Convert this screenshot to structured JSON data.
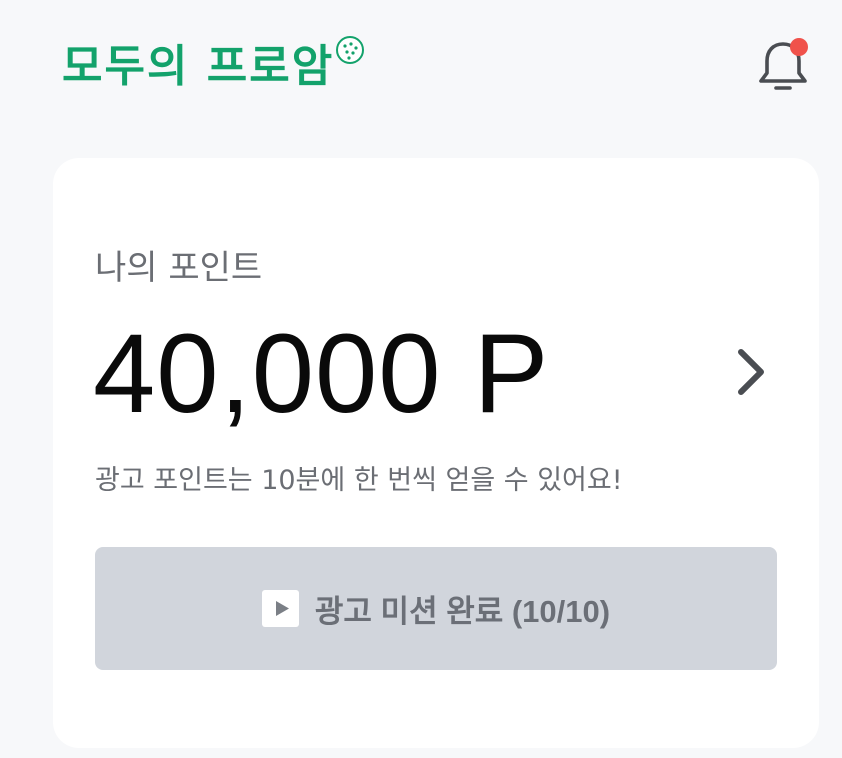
{
  "header": {
    "logo_text": "모두의 프로암",
    "logo_color": "#13a26b",
    "notification_icon": "bell-icon",
    "notification_badge_color": "#f0524b"
  },
  "points_card": {
    "label": "나의 포인트",
    "value": "40,000 P",
    "detail_icon": "chevron-right-icon",
    "info_text": "광고 포인트는 10분에 한 번씩 얻을 수 있어요!",
    "mission_button": {
      "icon": "play-icon",
      "label": "광고 미션 완료 (10/10)",
      "state": "disabled"
    }
  }
}
